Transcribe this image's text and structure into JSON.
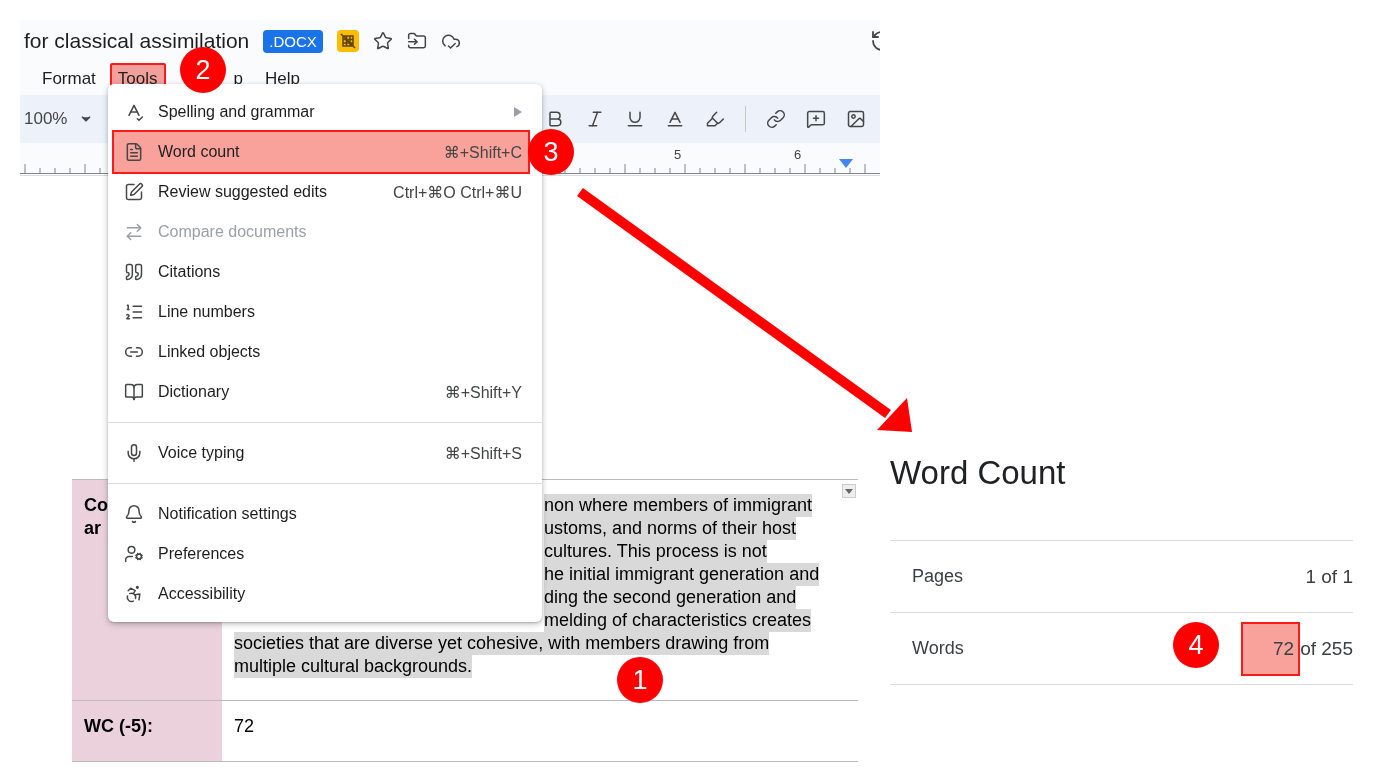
{
  "document": {
    "title": "for classical assimilation",
    "badge": ".DOCX",
    "menubar": [
      {
        "label": "Format",
        "highlighted": false
      },
      {
        "label": "Tools",
        "highlighted": true
      },
      {
        "label": "p",
        "highlighted": false
      },
      {
        "label": "Help",
        "highlighted": false
      }
    ],
    "zoom": "100%",
    "ruler": [
      "5",
      "6"
    ],
    "table": {
      "rows": [
        {
          "label_lines": [
            "Co",
            "ar"
          ],
          "lines": [
            {
              "text": "non where members of immigrant",
              "kind": "clipped"
            },
            {
              "text": "ustoms, and norms of their host",
              "kind": "clipped"
            },
            {
              "text": "cultures. This process is not",
              "kind": "clipped"
            },
            {
              "text": "he initial immigrant generation and",
              "kind": "clipped"
            },
            {
              "text": "ding the second generation and",
              "kind": "clipped"
            },
            {
              "text": "melding of characteristics creates",
              "kind": "clipped"
            },
            {
              "text": "societies that are diverse yet cohesive, with members drawing from",
              "kind": "full"
            },
            {
              "text": "multiple cultural backgrounds.",
              "kind": "full"
            }
          ]
        },
        {
          "label_lines": [
            "WC (-5):"
          ],
          "lines": [
            {
              "text": "72",
              "kind": "plain"
            }
          ]
        }
      ]
    }
  },
  "tools_menu": {
    "items": [
      {
        "kind": "item",
        "label": "Spelling and grammar",
        "submenu": true,
        "disabled": false,
        "highlighted": false
      },
      {
        "kind": "item",
        "label": "Word count",
        "shortcut": "⌘+Shift+C",
        "submenu": false,
        "disabled": false,
        "highlighted": true
      },
      {
        "kind": "item",
        "label": "Review suggested edits",
        "shortcut": "Ctrl+⌘O Ctrl+⌘U",
        "submenu": false,
        "disabled": false,
        "highlighted": false
      },
      {
        "kind": "item",
        "label": "Compare documents",
        "submenu": false,
        "disabled": true,
        "highlighted": false
      },
      {
        "kind": "item",
        "label": "Citations",
        "submenu": false,
        "disabled": false,
        "highlighted": false
      },
      {
        "kind": "item",
        "label": "Line numbers",
        "submenu": false,
        "disabled": false,
        "highlighted": false
      },
      {
        "kind": "item",
        "label": "Linked objects",
        "submenu": false,
        "disabled": false,
        "highlighted": false
      },
      {
        "kind": "item",
        "label": "Dictionary",
        "shortcut": "⌘+Shift+Y",
        "submenu": false,
        "disabled": false,
        "highlighted": false
      },
      {
        "kind": "separator"
      },
      {
        "kind": "item",
        "label": "Voice typing",
        "shortcut": "⌘+Shift+S",
        "submenu": false,
        "disabled": false,
        "highlighted": false
      },
      {
        "kind": "separator"
      },
      {
        "kind": "item",
        "label": "Notification settings",
        "submenu": false,
        "disabled": false,
        "highlighted": false
      },
      {
        "kind": "item",
        "label": "Preferences",
        "submenu": false,
        "disabled": false,
        "highlighted": false
      },
      {
        "kind": "item",
        "label": "Accessibility",
        "submenu": false,
        "disabled": false,
        "highlighted": false
      }
    ]
  },
  "word_count": {
    "title": "Word Count",
    "rows": [
      {
        "label": "Pages",
        "value": "1 of 1"
      },
      {
        "label": "Words",
        "count": "72",
        "rest": "of 255",
        "highlighted": true
      }
    ]
  },
  "annotations": [
    "1",
    "2",
    "3",
    "4"
  ]
}
